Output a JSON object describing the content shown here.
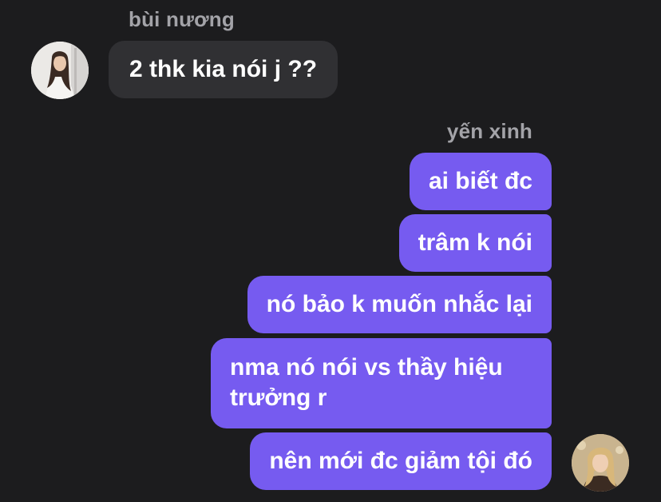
{
  "conversation": {
    "incoming": {
      "sender_name": "bùi nương",
      "avatar_icon": "profile-photo-woman-long-dark-hair",
      "messages": [
        "2 thk kia nói j ??"
      ]
    },
    "outgoing": {
      "sender_name": "yến xinh",
      "avatar_icon": "profile-photo-woman-blonde-hair",
      "messages": [
        "ai biết đc",
        "trâm k nói",
        "nó bảo k muốn nhắc lại",
        "nma nó nói vs thầy hiệu trưởng r",
        "nên mới đc giảm tội đó"
      ]
    }
  },
  "colors": {
    "background": "#1c1c1e",
    "incoming_bubble": "#303033",
    "outgoing_bubble": "#765bf0",
    "sender_name": "#a3a3a8",
    "text": "#ffffff"
  }
}
